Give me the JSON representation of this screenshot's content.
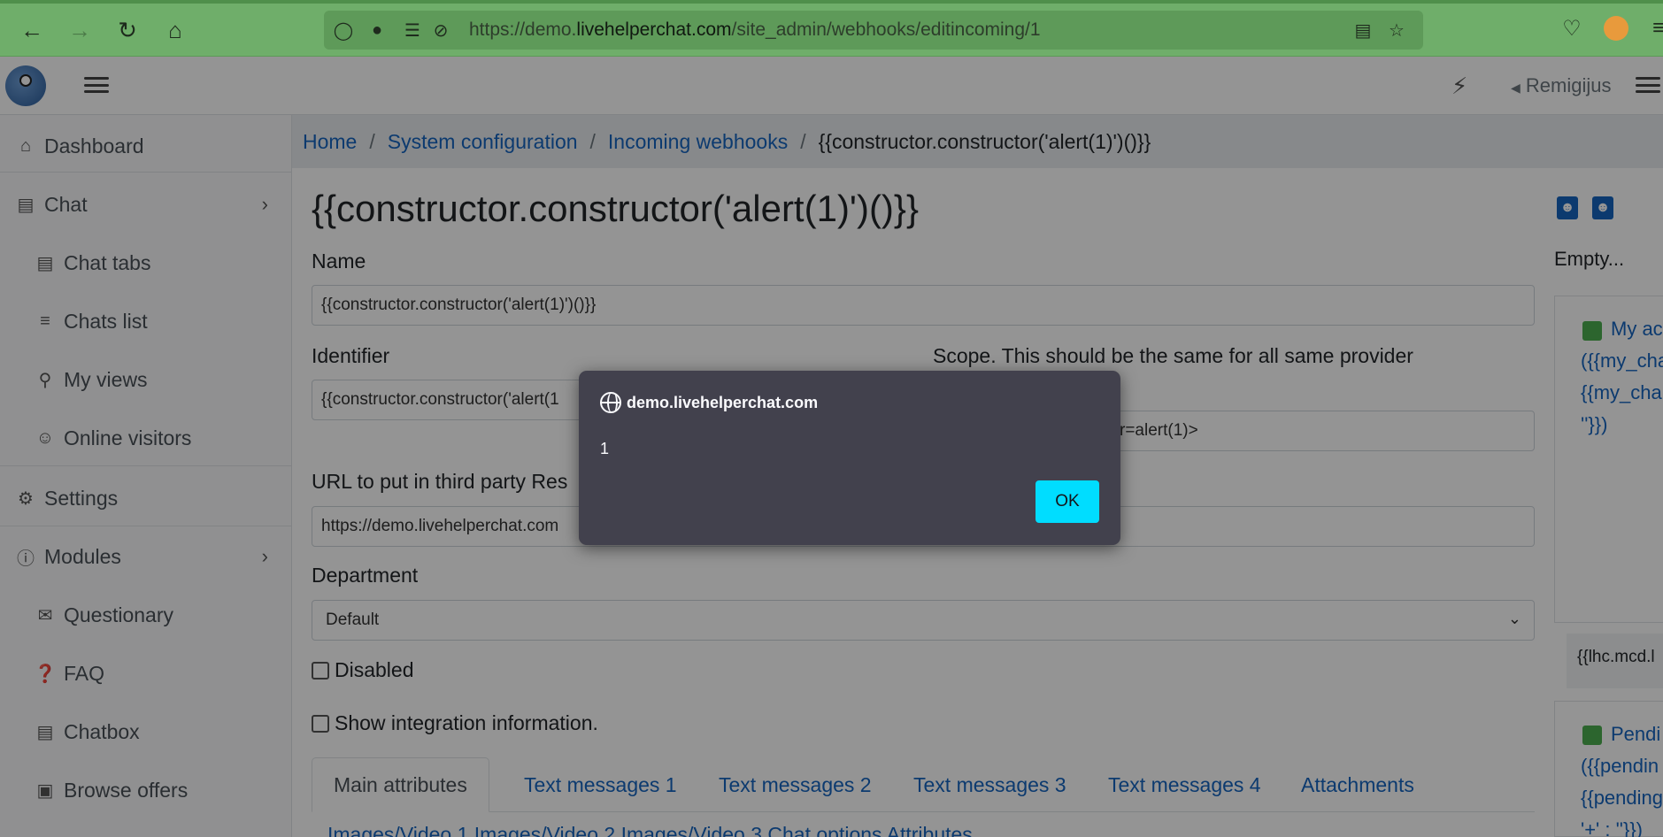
{
  "browser": {
    "url_prefix": "https://demo.",
    "url_host": "livehelperchat.com",
    "url_path": "/site_admin/webhooks/editincoming/1",
    "theme_color": "#6fae6a"
  },
  "header": {
    "user_name": "Remigijus"
  },
  "sidebar": {
    "items": [
      {
        "label": "Dashboard",
        "icon": "home-icon"
      },
      {
        "label": "Chat",
        "icon": "chat-icon"
      },
      {
        "label": "Chat tabs",
        "icon": "chat-icon"
      },
      {
        "label": "Chats list",
        "icon": "list-icon"
      },
      {
        "label": "My views",
        "icon": "search-icon"
      },
      {
        "label": "Online visitors",
        "icon": "face-icon"
      },
      {
        "label": "Settings",
        "icon": "gear-icon"
      },
      {
        "label": "Modules",
        "icon": "info-icon"
      },
      {
        "label": "Questionary",
        "icon": "mail-icon"
      },
      {
        "label": "FAQ",
        "icon": "help-icon"
      },
      {
        "label": "Chatbox",
        "icon": "chat-icon"
      },
      {
        "label": "Browse offers",
        "icon": "offer-icon"
      }
    ]
  },
  "breadcrumb": {
    "home": "Home",
    "system": "System configuration",
    "webhooks": "Incoming webhooks",
    "current": "{{constructor.constructor('alert(1)')()}}"
  },
  "form": {
    "title": "{{constructor.constructor('alert(1)')()}}",
    "name_label": "Name",
    "name_value": "{{constructor.constructor('alert(1)')()}}",
    "identifier_label": "Identifier",
    "identifier_value": "{{constructor.constructor('alert(1",
    "scope_label": "Scope. This should be the same for all same provider",
    "scope_value": "r=alert(1)>",
    "url_label": "URL to put in third party Res",
    "url_value": "https://demo.livehelperchat.com",
    "department_label": "Department",
    "department_value": "Default",
    "disabled_label": "Disabled",
    "show_integration_label": "Show integration information."
  },
  "tabs": [
    "Main attributes",
    "Text messages 1",
    "Text messages 2",
    "Text messages 3",
    "Text messages 4",
    "Attachments"
  ],
  "tabs_row2": "Images/Video 1    Images/Video 2    Images/Video 3    Chat options    Attributes",
  "right_panel": {
    "empty": "Empty...",
    "card1_lines": [
      "My ac",
      "({{my_cha",
      "{{my_cha",
      "''}})"
    ],
    "code": "{{lhc.mcd.l",
    "card2_lines": [
      "Pendi",
      "({{pendin",
      "{{pending",
      "'+' : ''}})"
    ]
  },
  "dialog": {
    "host": "demo.livehelperchat.com",
    "message": "1",
    "ok_label": "OK",
    "ok_color": "#00ddff"
  }
}
